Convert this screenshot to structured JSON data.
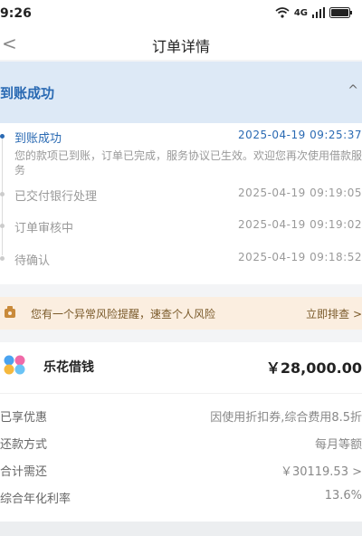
{
  "status": {
    "time": "9:26",
    "net": "4G"
  },
  "nav": {
    "back": "<",
    "title": "订单详情"
  },
  "banner": {
    "title": "到账成功",
    "chevron": "^"
  },
  "timeline": [
    {
      "label": "到账成功",
      "time": "2025-04-19 09:25:37",
      "desc": "您的款项已到账，订单已完成，服务协议已生效。欢迎您再次使用借款服务"
    },
    {
      "label": "已交付银行处理",
      "time": "2025-04-19 09:19:05"
    },
    {
      "label": "订单审核中",
      "time": "2025-04-19 09:19:02"
    },
    {
      "label": "待确认",
      "time": "2025-04-19 09:18:52"
    }
  ],
  "risk": {
    "text": "您有一个异常风险提醒，速查个人风险",
    "action": "立即排查 >"
  },
  "product": {
    "name": "乐花借钱",
    "amount": "￥28,000.00"
  },
  "details": [
    {
      "key": "已享优惠",
      "value": "因使用折扣券,综合费用8.5折"
    },
    {
      "key": "还款方式",
      "value": "每月等额"
    },
    {
      "key": "合计需还",
      "value": "￥30119.53 >"
    },
    {
      "key": "综合年化利率",
      "value": "13.6%"
    }
  ],
  "colors": {
    "accent": "#2a6ab3",
    "banner_bg": "#dde9f6",
    "risk_bg": "#fbeee0"
  },
  "icons": [
    "wifi-icon",
    "signal-icon",
    "battery-icon",
    "back-icon",
    "chevron-up-icon",
    "alarm-icon",
    "product-logo-icon"
  ]
}
